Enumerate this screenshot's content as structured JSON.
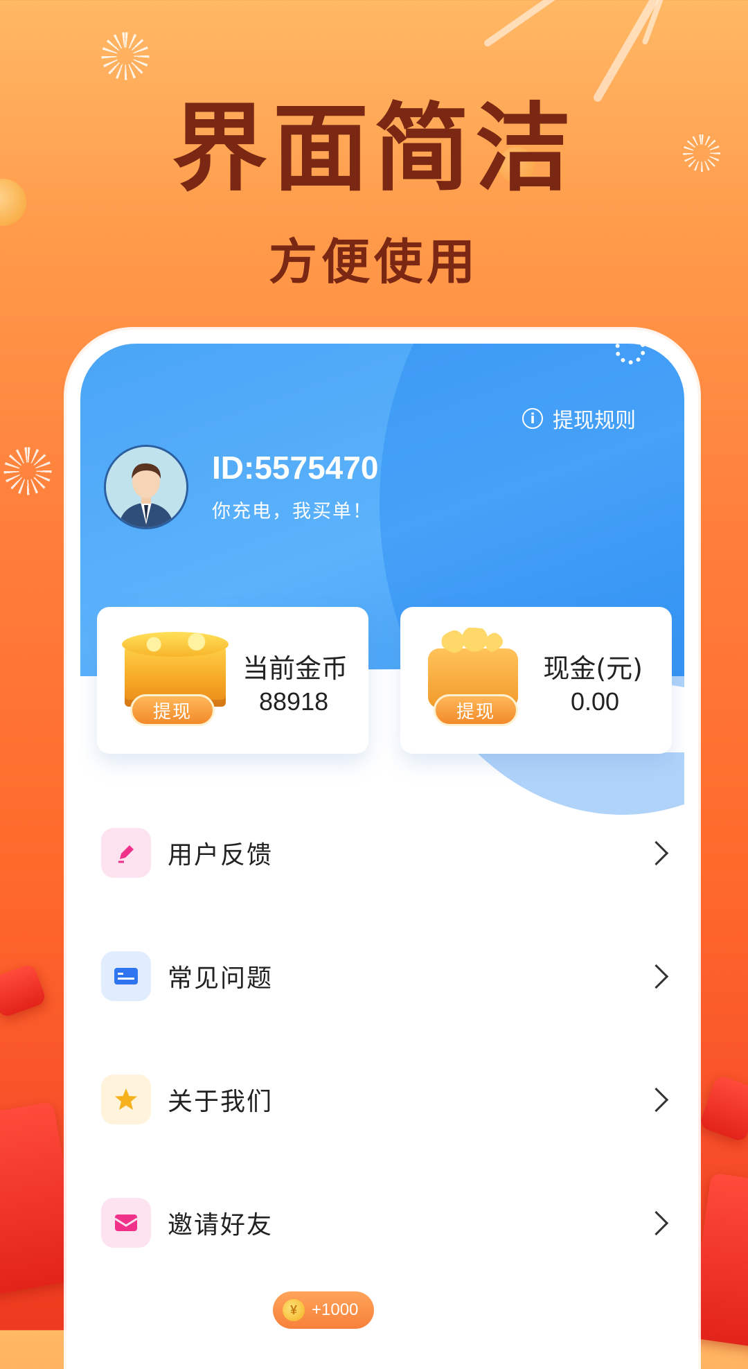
{
  "promo": {
    "headline": "界面简洁",
    "subheadline": "方便使用"
  },
  "header": {
    "rules_label": "提现规则",
    "user_id": "ID:5575470",
    "slogan": "你充电，我买单！"
  },
  "cards": {
    "coins": {
      "label": "当前金币",
      "value": "88918",
      "button": "提现"
    },
    "cash": {
      "label": "现金(元)",
      "value": "0.00",
      "button": "提现"
    }
  },
  "menu": {
    "items": [
      {
        "label": "用户反馈",
        "icon": "pen-icon",
        "bg": "#fde3ef",
        "color": "#f0318a"
      },
      {
        "label": "常见问题",
        "icon": "card-icon",
        "bg": "#e1ecfd",
        "color": "#2f74f0"
      },
      {
        "label": "关于我们",
        "icon": "star-icon",
        "bg": "#fff3dc",
        "color": "#f5b21d"
      },
      {
        "label": "邀请好友",
        "icon": "mail-icon",
        "bg": "#fde3ef",
        "color": "#f0318a"
      }
    ]
  },
  "reward": {
    "text": "+1000",
    "coin_symbol": "¥"
  },
  "colors": {
    "header_blue": "#4aa5f6",
    "headline_brown": "#7a2713",
    "accent_orange": "#f28a2a"
  }
}
